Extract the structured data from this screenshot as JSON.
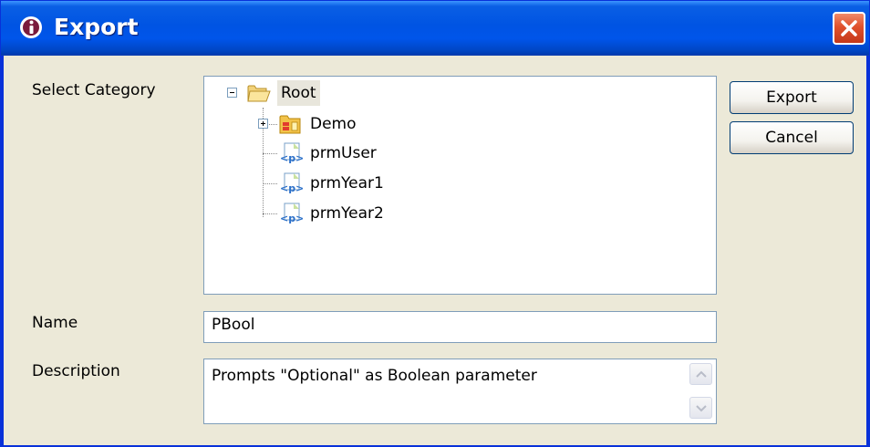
{
  "window": {
    "title": "Export",
    "app_icon": "info-icon",
    "close_icon": "close-icon"
  },
  "labels": {
    "select_category": "Select Category",
    "name": "Name",
    "description": "Description"
  },
  "tree": {
    "root": {
      "label": "Root",
      "icon": "folder-open-icon",
      "expanded": true
    },
    "children": [
      {
        "label": "Demo",
        "icon": "report-folder-icon",
        "expandable": true
      },
      {
        "label": "prmUser",
        "icon": "parameter-icon"
      },
      {
        "label": "prmYear1",
        "icon": "parameter-icon"
      },
      {
        "label": "prmYear2",
        "icon": "parameter-icon"
      }
    ]
  },
  "buttons": {
    "export": "Export",
    "cancel": "Cancel"
  },
  "fields": {
    "name_value": "PBool",
    "description_value": "Prompts \"Optional\" as Boolean parameter"
  }
}
